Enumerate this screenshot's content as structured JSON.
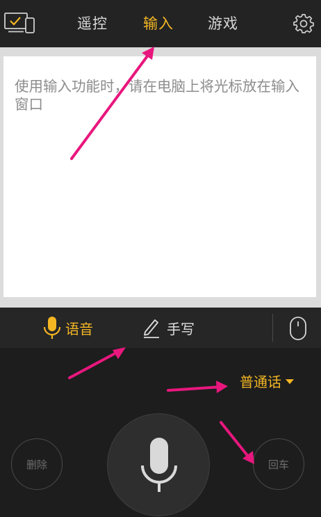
{
  "header": {
    "tabs": [
      {
        "label": "遥控"
      },
      {
        "label": "输入"
      },
      {
        "label": "游戏"
      }
    ]
  },
  "input": {
    "placeholder": "使用输入功能时，请在电脑上将光标放在输入窗口",
    "value": ""
  },
  "modes": {
    "voice_label": "语音",
    "handwrite_label": "手写"
  },
  "voice": {
    "language": "普通话",
    "delete_label": "删除",
    "enter_label": "回车"
  },
  "colors": {
    "accent": "#f3b623",
    "annotation_arrow": "#e8177d",
    "background": "#1d1d1e"
  },
  "icons": [
    "devices-icon",
    "settings-icon",
    "microphone-icon",
    "pencil-icon",
    "mouse-icon",
    "dropdown-caret-icon",
    "large-microphone-icon"
  ]
}
